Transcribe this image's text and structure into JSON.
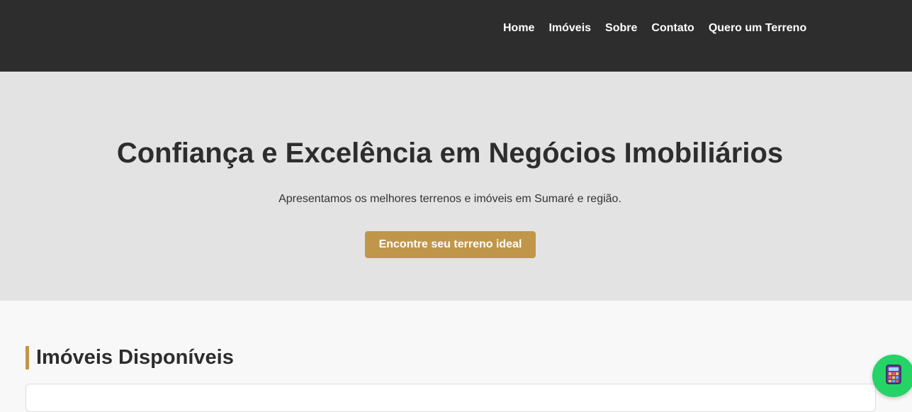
{
  "nav": {
    "items": [
      {
        "label": "Home"
      },
      {
        "label": "Imóveis"
      },
      {
        "label": "Sobre"
      },
      {
        "label": "Contato"
      },
      {
        "label": "Quero um Terreno"
      }
    ]
  },
  "hero": {
    "title": "Confiança e Excelência em Negócios Imobiliários",
    "subtitle": "Apresentamos os melhores terrenos e imóveis em Sumaré e região.",
    "cta_label": "Encontre seu terreno ideal"
  },
  "listings": {
    "heading": "Imóveis Disponíveis"
  },
  "floating_button": {
    "icon": "calculator-icon"
  },
  "colors": {
    "header_bg": "#2d2d2d",
    "hero_bg": "#e3e3e3",
    "accent": "#c0964a",
    "float_button_bg": "#25d366"
  }
}
